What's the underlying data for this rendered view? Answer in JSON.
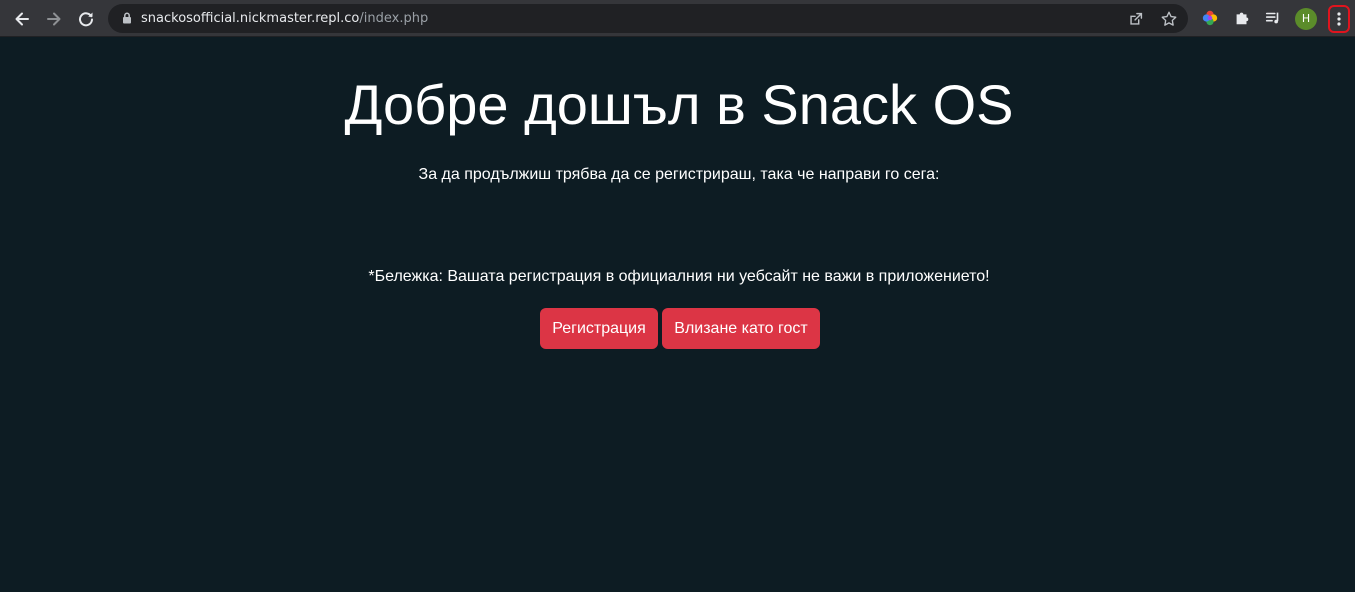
{
  "browser": {
    "url_host": "snackosofficial.nickmaster.repl.co",
    "url_path": "/index.php",
    "profile_initial": "H"
  },
  "colors": {
    "page_background": "#0d1c23",
    "button_background": "#dc3545",
    "text": "#ffffff",
    "menu_highlight": "#e0141e"
  },
  "page": {
    "title": "Добре дошъл в Snack OS",
    "subtitle": "За да продължиш трябва да се регистрираш, така че направи го сега:",
    "note": "*Бележка: Вашата регистрация в официалния ни уебсайт не важи в приложението!",
    "buttons": {
      "register_label": "Регистрация",
      "guest_label": "Влизане като гост"
    }
  }
}
